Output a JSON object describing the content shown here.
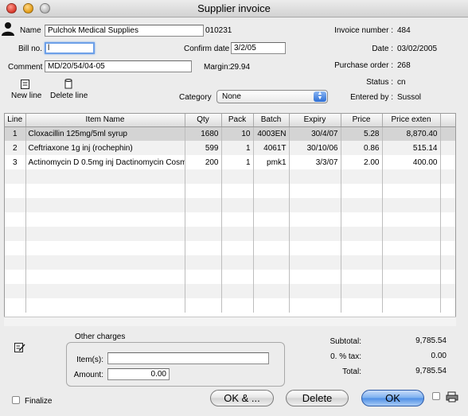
{
  "window": {
    "title": "Supplier invoice"
  },
  "header": {
    "name_label": "Name",
    "name_value": "Pulchok Medical Supplies",
    "supplier_code": "010231",
    "bill_label": "Bill no.",
    "bill_value": "l",
    "confirm_label": "Confirm date",
    "confirm_value": "3/2/05",
    "comment_label": "Comment",
    "comment_value": "MD/20/54/04-05",
    "margin_label": "Margin:",
    "margin_value": "29.94",
    "invoice_number_label": "Invoice number :",
    "invoice_number_value": "484",
    "date_label": "Date :",
    "date_value": "03/02/2005",
    "purchase_order_label": "Purchase order :",
    "purchase_order_value": "268",
    "status_label": "Status :",
    "status_value": "cn",
    "entered_by_label": "Entered by :",
    "entered_by_value": "Sussol",
    "category_label": "Category",
    "category_value": "None"
  },
  "toolbar": {
    "new_line_label": "New line",
    "delete_line_label": "Delete line"
  },
  "table": {
    "columns": [
      "Line",
      "Item Name",
      "Qty",
      "Pack",
      "Batch",
      "Expiry",
      "Price",
      "Price exten"
    ],
    "rows": [
      {
        "line": "1",
        "item": "Cloxacillin 125mg/5ml syrup",
        "qty": "1680",
        "pack": "10",
        "batch": "4003EN",
        "expiry": "30/4/07",
        "price": "5.28",
        "ext": "8,870.40"
      },
      {
        "line": "2",
        "item": "Ceftriaxone 1g inj (rochephin)",
        "qty": "599",
        "pack": "1",
        "batch": "4061T",
        "expiry": "30/10/06",
        "price": "0.86",
        "ext": "515.14"
      },
      {
        "line": "3",
        "item": "Actinomycin D 0.5mg inj Dactinomycin Cosm",
        "qty": "200",
        "pack": "1",
        "batch": "pmk1",
        "expiry": "3/3/07",
        "price": "2.00",
        "ext": "400.00"
      }
    ]
  },
  "other_charges": {
    "title": "Other charges",
    "items_label": "Item(s):",
    "items_value": "",
    "amount_label": "Amount:",
    "amount_value": "0.00"
  },
  "totals": {
    "subtotal_label": "Subtotal:",
    "subtotal_value": "9,785.54",
    "tax_label": "0.  % tax:",
    "tax_value": "0.00",
    "total_label": "Total:",
    "total_value": "9,785.54"
  },
  "footer": {
    "finalize_label": "Finalize",
    "ok_more_label": "OK & ...",
    "delete_label": "Delete",
    "ok_label": "OK"
  }
}
